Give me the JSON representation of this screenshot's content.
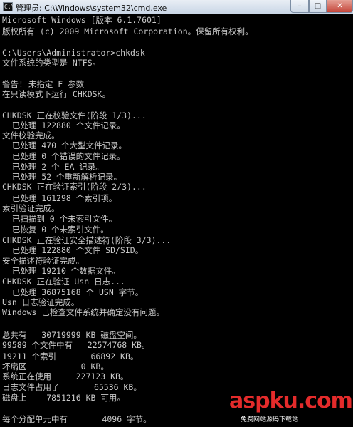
{
  "window": {
    "title": "管理员: C:\\Windows\\system32\\cmd.exe",
    "icon": "cmd-icon",
    "controls": [
      "minimize-icon",
      "maximize-icon",
      "close-icon"
    ]
  },
  "console": {
    "lines": [
      "Microsoft Windows [版本 6.1.7601]",
      "版权所有 (c) 2009 Microsoft Corporation。保留所有权利。",
      "",
      "C:\\Users\\Administrator>chkdsk",
      "文件系统的类型是 NTFS。",
      "",
      "警告! 未指定 F 参数",
      "在只读模式下运行 CHKDSK。",
      "",
      "CHKDSK 正在校验文件(阶段 1/3)...",
      "  已处理 122880 个文件记录。",
      "文件校验完成。",
      "  已处理 470 个大型文件记录。",
      "  已处理 0 个错误的文件记录。",
      "  已处理 2 个 EA 记录。",
      "  已处理 52 个重新解析记录。",
      "CHKDSK 正在验证索引(阶段 2/3)...",
      "  已处理 161298 个索引项。",
      "索引验证完成。",
      "  已扫描到 0 个未索引文件。",
      "  已恢复 0 个未索引文件。",
      "CHKDSK 正在验证安全描述符(阶段 3/3)...",
      "  已处理 122880 个文件 SD/SID。",
      "安全描述符验证完成。",
      "  已处理 19210 个数据文件。",
      "CHKDSK 正在验证 Usn 日志...",
      "  已处理 36875168 个 USN 字节。",
      "Usn 日志验证完成。",
      "Windows 已检查文件系统并确定没有问题。",
      "",
      "总共有   30719999 KB 磁盘空间。",
      "99589 个文件中有   22574768 KB。",
      "19211 个索引       66892 KB。",
      "坏扇区           0 KB。",
      "系统正在使用     227123 KB。",
      "日志文件占用了       65536 KB。",
      "磁盘上    7851216 KB 可用。",
      "",
      "每个分配单元中有       4096 字节。"
    ]
  },
  "watermark": {
    "brand": "aspku",
    "tld": ".com",
    "sub": "免费网站源码下载站"
  },
  "colors": {
    "console_bg": "#000000",
    "console_text": "#c8c8c8",
    "watermark": "#e42b2b"
  }
}
